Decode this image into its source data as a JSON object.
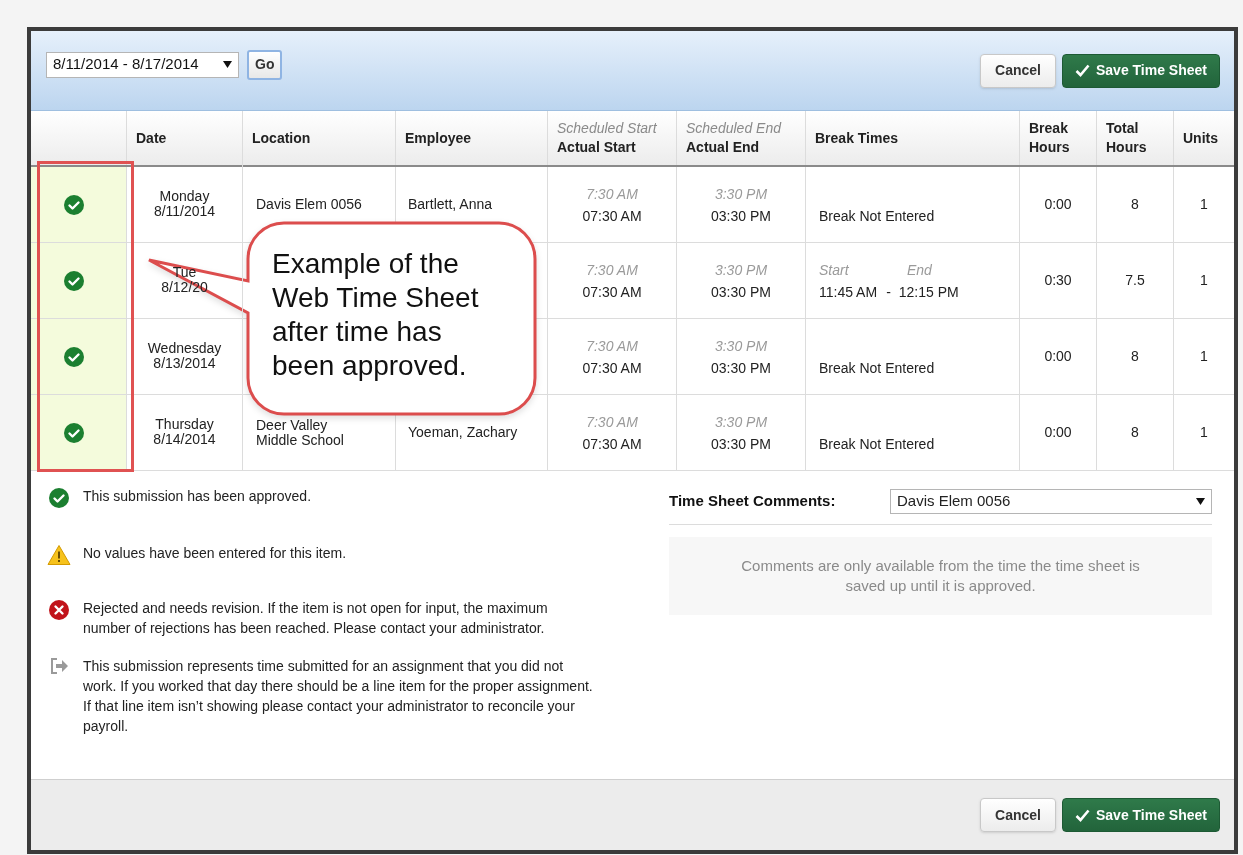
{
  "toolbar": {
    "period": "8/11/2014 - 8/17/2014",
    "go": "Go",
    "cancel": "Cancel",
    "save": "Save Time Sheet"
  },
  "table": {
    "columns": [
      {
        "label": "Date"
      },
      {
        "label": "Location"
      },
      {
        "label": "Employee"
      },
      {
        "sub": "Scheduled Start",
        "label": "Actual Start"
      },
      {
        "sub": "Scheduled End",
        "label": "Actual End"
      },
      {
        "label": "Break Times"
      },
      {
        "label": "Break Hours"
      },
      {
        "label": "Total Hours"
      },
      {
        "label": "Units"
      }
    ],
    "rows": [
      {
        "kind": "approved",
        "day": "Monday",
        "date": "8/11/2014",
        "location": "Davis Elem 0056",
        "employee": "Bartlett, Anna",
        "scheduled_start": "7:30 AM",
        "actual_start": "07:30 AM",
        "scheduled_end": "3:30 PM",
        "actual_end": "03:30 PM",
        "break": {
          "kind": "none",
          "text": "Break Not Entered"
        },
        "break_hours": "0:00",
        "total_hours": "8",
        "units": "1"
      },
      {
        "kind": "approved",
        "day": "Tue",
        "date": "8/12/20",
        "scheduled_start": "7:30 AM",
        "actual_start": "07:30 AM",
        "scheduled_end": "3:30 PM",
        "actual_end": "03:30 PM",
        "break": {
          "kind": "range",
          "start_label": "Start",
          "end_label": "End",
          "start": "11:45 AM",
          "separator": "-",
          "end": "12:15 PM"
        },
        "break_hours": "0:30",
        "total_hours": "7.5",
        "units": "1"
      },
      {
        "kind": "approved",
        "day": "Wednesday",
        "date": "8/13/2014",
        "scheduled_start": "7:30 AM",
        "actual_start": "07:30 AM",
        "scheduled_end": "3:30 PM",
        "actual_end": "03:30 PM",
        "break": {
          "kind": "none",
          "text": "Break Not Entered"
        },
        "break_hours": "0:00",
        "total_hours": "8",
        "units": "1"
      },
      {
        "kind": "approved",
        "day": "Thursday",
        "date": "8/14/2014",
        "location": "Deer Valley\nMiddle School",
        "employee": "Yoeman, Zachary",
        "scheduled_start": "7:30 AM",
        "actual_start": "07:30 AM",
        "scheduled_end": "3:30 PM",
        "actual_end": "03:30 PM",
        "break": {
          "kind": "none",
          "text": "Break Not Entered"
        },
        "break_hours": "0:00",
        "total_hours": "8",
        "units": "1"
      }
    ]
  },
  "legend": [
    {
      "kind": "approved",
      "text": "This submission has been approved."
    },
    {
      "kind": "warning",
      "text": "No values have been entered for this item."
    },
    {
      "kind": "rejected",
      "text": "Rejected and needs revision. If the item is not open for input, the maximum number of rejections has been reached. Please contact your administrator."
    },
    {
      "kind": "not_worked",
      "text": "This submission represents time submitted for an assignment that you did not work. If you worked that day there should be a line item for the proper assignment. If that line item isn’t showing please contact your administrator to reconcile your payroll."
    }
  ],
  "comments": {
    "label": "Time Sheet Comments:",
    "location": "Davis Elem 0056",
    "note": "Comments are only available from the time the time sheet is saved up until it is approved."
  },
  "footer": {
    "cancel": "Cancel",
    "save": "Save Time Sheet"
  },
  "callout": {
    "text": "Example of the Web Time Sheet after time has been approved."
  }
}
